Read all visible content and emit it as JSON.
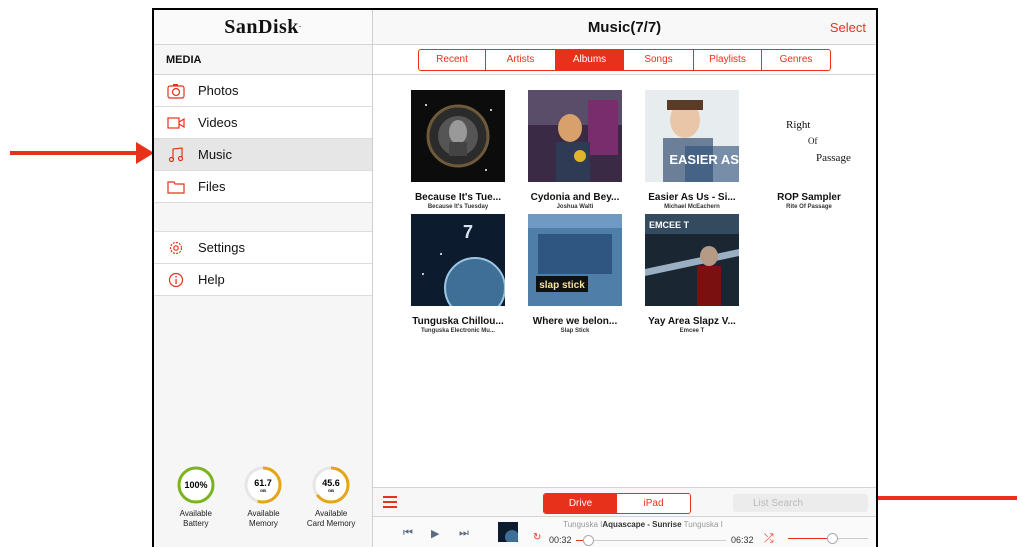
{
  "sidebar": {
    "brand": "SanDisk",
    "brand_mark": "·",
    "section": "MEDIA",
    "items": [
      {
        "label": "Photos",
        "icon": "camera-icon"
      },
      {
        "label": "Videos",
        "icon": "video-camera-icon"
      },
      {
        "label": "Music",
        "icon": "music-note-icon"
      },
      {
        "label": "Files",
        "icon": "folder-icon"
      },
      {
        "label": "Settings",
        "icon": "gear-icon"
      },
      {
        "label": "Help",
        "icon": "info-icon"
      }
    ],
    "gauges": [
      {
        "value": "100%",
        "unit": "",
        "label1": "Available",
        "label2": "Battery",
        "fraction": 1.0
      },
      {
        "value": "61.7",
        "unit": "GB",
        "label1": "Available",
        "label2": "Memory",
        "fraction": 0.55
      },
      {
        "value": "45.6",
        "unit": "GB",
        "label1": "Available",
        "label2": "Card Memory",
        "fraction": 0.65
      }
    ]
  },
  "main": {
    "title": "Music(7/7)",
    "select_label": "Select",
    "tabs": [
      {
        "label": "Recent"
      },
      {
        "label": "Artists"
      },
      {
        "label": "Albums"
      },
      {
        "label": "Songs"
      },
      {
        "label": "Playlists"
      },
      {
        "label": "Genres"
      }
    ],
    "active_tab": "Albums",
    "albums": [
      {
        "title": "Because It's Tue...",
        "artist": "Because It's Tuesday"
      },
      {
        "title": "Cydonia and Bey...",
        "artist": "Joshua Walti"
      },
      {
        "title": "Easier As Us - Si...",
        "artist": "Michael McEachern",
        "cover_text": "EASIER AS US"
      },
      {
        "title": "ROP Sampler",
        "artist": "Rite Of Passage",
        "cover_text_1": "Right",
        "cover_text_2": "Of",
        "cover_text_3": "Passage"
      },
      {
        "title": "Tunguska Chillou...",
        "artist": "Tunguska Electronic Mu...",
        "cover_text": "7"
      },
      {
        "title": "Where we belon...",
        "artist": "Slap Stick",
        "cover_text": "slap stick"
      },
      {
        "title": "Yay Area Slapz V...",
        "artist": "Emcee T",
        "cover_text": "EMCEE T"
      }
    ]
  },
  "bottom": {
    "source_options": [
      "Drive",
      "iPad"
    ],
    "active_source": "Drive",
    "search_placeholder": "List Search"
  },
  "player": {
    "now_playing_prefix": "Tunguska I",
    "now_playing_title": "Aquascape - Sunrise",
    "now_playing_suffix": " Tunguska I",
    "elapsed": "00:32",
    "remaining": "06:32",
    "progress": 0.08,
    "volume": 0.55
  },
  "colors": {
    "accent": "#e8311b",
    "gauge_green": "#7ab51d",
    "gauge_amber": "#e6a417"
  }
}
